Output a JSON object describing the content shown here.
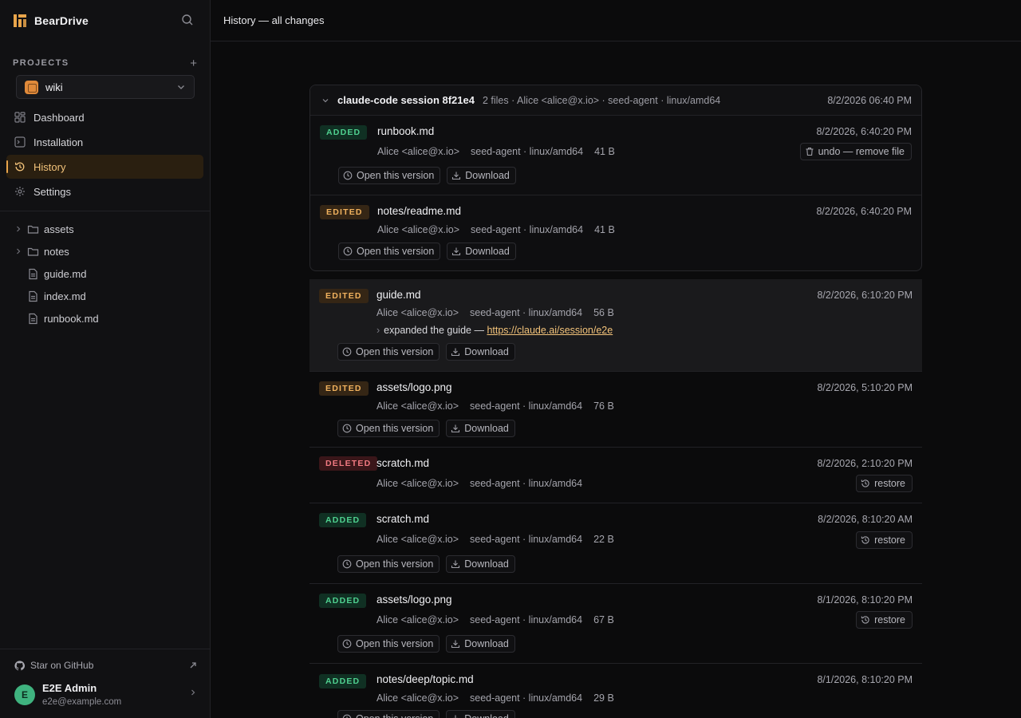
{
  "brand": {
    "name": "BearDrive",
    "accent": "#e9a54b"
  },
  "sidebar": {
    "projects_label": "PROJECTS",
    "add_label": "+",
    "project": {
      "name": "wiki",
      "icon_color": "#e08a3a"
    },
    "nav": [
      {
        "label": "Dashboard",
        "icon": "grid-icon",
        "active": false
      },
      {
        "label": "Installation",
        "icon": "terminal-icon",
        "active": false
      },
      {
        "label": "History",
        "icon": "history-icon",
        "active": true
      },
      {
        "label": "Settings",
        "icon": "gear-icon",
        "active": false
      }
    ],
    "tree": [
      {
        "name": "assets",
        "type": "folder"
      },
      {
        "name": "notes",
        "type": "folder"
      },
      {
        "name": "guide.md",
        "type": "file"
      },
      {
        "name": "index.md",
        "type": "file"
      },
      {
        "name": "runbook.md",
        "type": "file"
      }
    ],
    "github_label": "Star on GitHub",
    "user": {
      "initial": "E",
      "name": "E2E Admin",
      "email": "e2e@example.com"
    }
  },
  "topbar": {
    "title": "History — all changes"
  },
  "session": {
    "name": "claude-code session 8f21e4",
    "meta": "2 files · Alice <alice@x.io> · seed-agent · linux/amd64",
    "date": "8/2/2026 06:40 PM"
  },
  "actions": {
    "open": "Open this version",
    "download": "Download",
    "restore": "restore",
    "undo": "undo — remove file"
  },
  "entries": [
    {
      "status": "ADDED",
      "file": "runbook.md",
      "author": "Alice <alice@x.io>",
      "agent": "seed-agent · linux/amd64",
      "size": "41 B",
      "date": "8/2/2026, 6:40:20 PM"
    },
    {
      "status": "EDITED",
      "file": "notes/readme.md",
      "author": "Alice <alice@x.io>",
      "agent": "seed-agent · linux/amd64",
      "size": "41 B",
      "date": "8/2/2026, 6:40:20 PM"
    },
    {
      "status": "EDITED",
      "file": "guide.md",
      "author": "Alice <alice@x.io>",
      "agent": "seed-agent · linux/amd64",
      "size": "56 B",
      "date": "8/2/2026, 6:10:20 PM",
      "note": "expanded the guide —",
      "note_link": "https://claude.ai/session/e2e"
    },
    {
      "status": "EDITED",
      "file": "assets/logo.png",
      "author": "Alice <alice@x.io>",
      "agent": "seed-agent · linux/amd64",
      "size": "76 B",
      "date": "8/2/2026, 5:10:20 PM"
    },
    {
      "status": "DELETED",
      "file": "scratch.md",
      "author": "Alice <alice@x.io>",
      "agent": "seed-agent · linux/amd64",
      "size": "",
      "date": "8/2/2026, 2:10:20 PM"
    },
    {
      "status": "ADDED",
      "file": "scratch.md",
      "author": "Alice <alice@x.io>",
      "agent": "seed-agent · linux/amd64",
      "size": "22 B",
      "date": "8/2/2026, 8:10:20 AM"
    },
    {
      "status": "ADDED",
      "file": "assets/logo.png",
      "author": "Alice <alice@x.io>",
      "agent": "seed-agent · linux/amd64",
      "size": "67 B",
      "date": "8/1/2026, 8:10:20 PM"
    },
    {
      "status": "ADDED",
      "file": "notes/deep/topic.md",
      "author": "Alice <alice@x.io>",
      "agent": "seed-agent · linux/amd64",
      "size": "29 B",
      "date": "8/1/2026, 8:10:20 PM"
    }
  ]
}
